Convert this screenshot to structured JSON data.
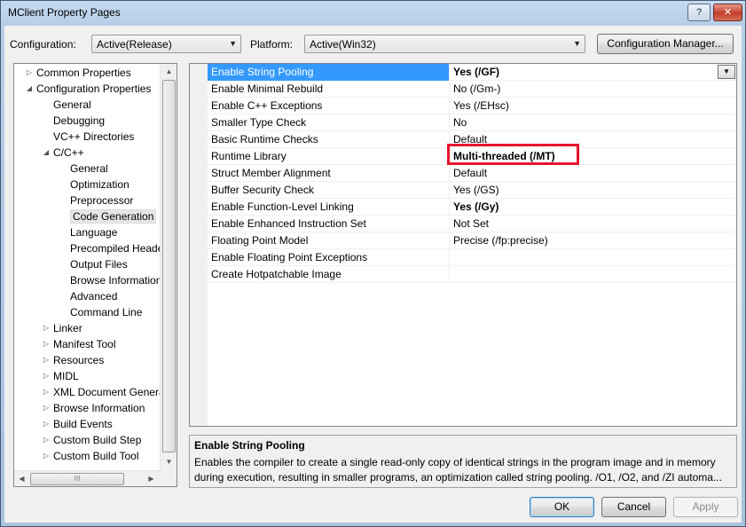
{
  "window": {
    "title": "MClient Property Pages",
    "help_label": "?",
    "close_label": "✕"
  },
  "toolbar": {
    "configuration_label": "Configuration:",
    "configuration_value": "Active(Release)",
    "platform_label": "Platform:",
    "platform_value": "Active(Win32)",
    "config_manager_label": "Configuration Manager..."
  },
  "tree": {
    "items": [
      {
        "label": "Common Properties",
        "expander": "▷"
      },
      {
        "label": "Configuration Properties",
        "expander": "◢"
      },
      {
        "label": "General"
      },
      {
        "label": "Debugging"
      },
      {
        "label": "VC++ Directories"
      },
      {
        "label": "C/C++",
        "expander": "◢"
      },
      {
        "label": "General"
      },
      {
        "label": "Optimization"
      },
      {
        "label": "Preprocessor"
      },
      {
        "label": "Code Generation"
      },
      {
        "label": "Language"
      },
      {
        "label": "Precompiled Headers"
      },
      {
        "label": "Output Files"
      },
      {
        "label": "Browse Information"
      },
      {
        "label": "Advanced"
      },
      {
        "label": "Command Line"
      },
      {
        "label": "Linker",
        "expander": "▷"
      },
      {
        "label": "Manifest Tool",
        "expander": "▷"
      },
      {
        "label": "Resources",
        "expander": "▷"
      },
      {
        "label": "MIDL",
        "expander": "▷"
      },
      {
        "label": "XML Document Generator",
        "expander": "▷"
      },
      {
        "label": "Browse Information",
        "expander": "▷"
      },
      {
        "label": "Build Events",
        "expander": "▷"
      },
      {
        "label": "Custom Build Step",
        "expander": "▷"
      },
      {
        "label": "Custom Build Tool",
        "expander": "▷"
      }
    ],
    "selected_index": 9
  },
  "grid": {
    "rows": [
      {
        "name": "Enable String Pooling",
        "value": "Yes (/GF)"
      },
      {
        "name": "Enable Minimal Rebuild",
        "value": "No (/Gm-)"
      },
      {
        "name": "Enable C++ Exceptions",
        "value": "Yes (/EHsc)"
      },
      {
        "name": "Smaller Type Check",
        "value": "No"
      },
      {
        "name": "Basic Runtime Checks",
        "value": "Default"
      },
      {
        "name": "Runtime Library",
        "value": "Multi-threaded (/MT)"
      },
      {
        "name": "Struct Member Alignment",
        "value": "Default"
      },
      {
        "name": "Buffer Security Check",
        "value": "Yes (/GS)"
      },
      {
        "name": "Enable Function-Level Linking",
        "value": "Yes (/Gy)"
      },
      {
        "name": "Enable Enhanced Instruction Set",
        "value": "Not Set"
      },
      {
        "name": "Floating Point Model",
        "value": "Precise (/fp:precise)"
      },
      {
        "name": "Enable Floating Point Exceptions",
        "value": ""
      },
      {
        "name": "Create Hotpatchable Image",
        "value": ""
      }
    ],
    "dropdown_arrow": "▼",
    "highlight_color": "#e8142a"
  },
  "description": {
    "title": "Enable String Pooling",
    "text": "Enables the compiler to create a single read-only copy of identical strings in the program image and in memory during execution, resulting in smaller programs, an optimization called string pooling. /O1, /O2, and /ZI automa..."
  },
  "buttons": {
    "ok": "OK",
    "cancel": "Cancel",
    "apply": "Apply"
  },
  "scroll": {
    "up": "▲",
    "down": "▼",
    "left": "◀",
    "right": "▶",
    "grip": "III"
  }
}
